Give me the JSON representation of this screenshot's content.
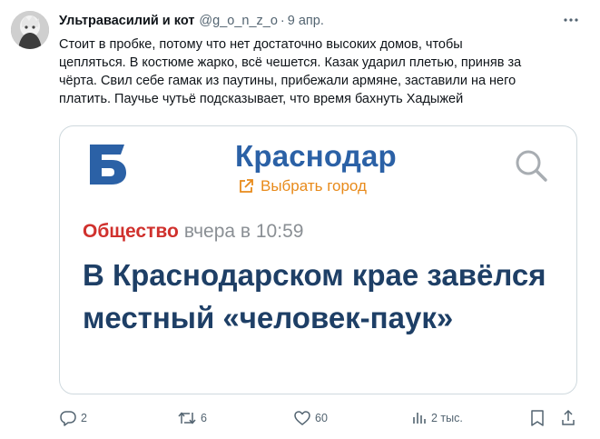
{
  "tweet": {
    "display_name": "Ультравасилий и кот",
    "handle": "@g_o_n_z_o",
    "separator": "·",
    "date": "9 апр.",
    "text": "Стоит в пробке, потому что нет достаточно высоких домов, чтобы\nцепляться. В костюме жарко, всё чешется. Казак ударил плетью, приняв за\nчёрта. Свил себе гамак из паутины, прибежали армяне, заставили на него\nплатить. Паучье чутьё подсказывает, что время бахнуть Хадыжей"
  },
  "card": {
    "logo_icon": "b-letter-logo",
    "logo_color": "#2b61a6",
    "city": "Краснодар",
    "choose_city": "Выбрать город",
    "category": "Общество",
    "time": "вчера в 10:59",
    "headline": "В Краснодарском крае завёлся местный «человек-паук»"
  },
  "actions": {
    "replies": "2",
    "retweets": "6",
    "likes": "60",
    "views": "2 тыс."
  },
  "colors": {
    "accent_blue": "#2b61a6",
    "category_red": "#d0312d",
    "choose_orange": "#e88a1a",
    "headline_navy": "#1e3f66",
    "secondary_text": "#536471"
  }
}
